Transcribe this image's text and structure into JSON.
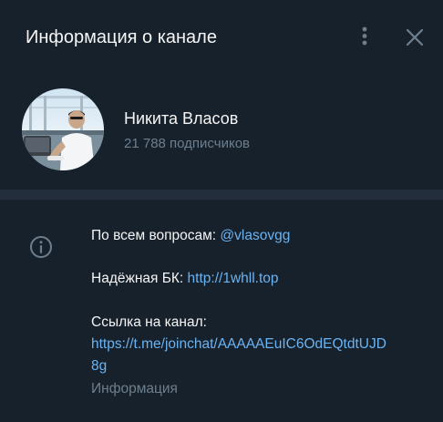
{
  "header": {
    "title": "Информация о канале",
    "menu_icon": "more-vertical-icon",
    "close_icon": "close-icon"
  },
  "channel": {
    "name": "Никита Власов",
    "subscribers": "21 788 подписчиков",
    "avatar_icon": "avatar-photo"
  },
  "description": {
    "line1_prefix": "По всем вопросам: ",
    "line1_link": "@vlasovgg",
    "line2_prefix": "Надёжная БК: ",
    "line2_link": "http://1whll.top",
    "line3_text": "Ссылка на канал:",
    "line4_link_part1": "https://t.me/joinchat/AAAAAEuIC6OdEQtdtUJD",
    "line4_link_part2": "8g",
    "info_icon": "info-icon"
  },
  "footer": {
    "label": "Информация"
  },
  "colors": {
    "background": "#17212b",
    "divider": "#232e3c",
    "text": "#f5f5f5",
    "muted": "#6d7f8f",
    "link": "#6ab3f3"
  }
}
